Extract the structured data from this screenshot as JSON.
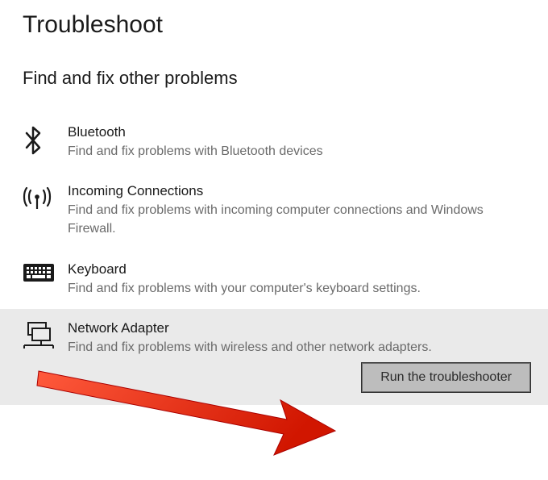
{
  "page_title": "Troubleshoot",
  "section_title": "Find and fix other problems",
  "items": [
    {
      "icon": "bluetooth-icon",
      "title": "Bluetooth",
      "desc": "Find and fix problems with Bluetooth devices"
    },
    {
      "icon": "connections-icon",
      "title": "Incoming Connections",
      "desc": "Find and fix problems with incoming computer connections and Windows Firewall."
    },
    {
      "icon": "keyboard-icon",
      "title": "Keyboard",
      "desc": "Find and fix problems with your computer's keyboard settings."
    },
    {
      "icon": "network-adapter-icon",
      "title": "Network Adapter",
      "desc": "Find and fix problems with wireless and other network adapters."
    }
  ],
  "run_button_label": "Run the troubleshooter",
  "colors": {
    "selected_bg": "#eaeaea",
    "desc_text": "#6a6a6a",
    "arrow": "#e53419"
  }
}
